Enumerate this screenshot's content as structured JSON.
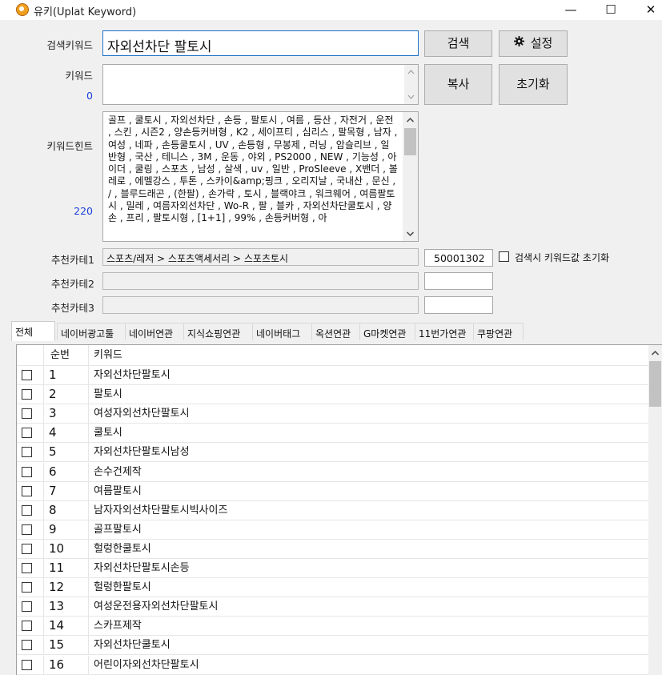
{
  "window": {
    "title": "유키(Uplat Keyword)",
    "icon": "app-logo-icon",
    "controls": [
      "—",
      "☐",
      "✕"
    ]
  },
  "form": {
    "search_label": "검색키워드",
    "search_value": "자외선차단 팔토시",
    "keyword_label": "키워드",
    "keyword_count": "0",
    "hint_label": "키워드힌트",
    "hint_count": "220",
    "hint_text": "골프 , 쿨토시 , 자외선차단 , 손등 , 팔토시 , 여름 , 등산 , 자전거 , 운전 , 스킨 , 시즌2 , 양손등커버형 , K2 , 세이프티 , 심리스 , 팔목형 , 남자 , 여성 , 네파 , 손등쿨토시 , UV , 손등형 , 무봉제 , 러닝 , 암슬리브 , 일반형 , 국산 , 테니스 , 3M , 운동 , 야외 , PS2000 , NEW , 기능성 , 아이더 , 쿨링 , 스포츠 , 남성 , 살색 , uv , 일반 , ProSleeve , X밴더 , 볼레로 , 에멜강스 , 투톤 , 스카이&amp;핑크 , 오리지날 , 국내산 , 문신 , / , 블루드래곤 , (한팔) , 손가락 , 토시 , 블랙야크 , 워크웨어 , 여름팔토시 , 밀레 , 여름자외선차단 , Wo-R , 팔 , 블카 , 자외선차단쿨토시 , 양손 , 프리 , 팔토시형 , [1+1] , 99% , 손등커버형 , 아",
    "buttons": {
      "search": "검색",
      "settings": "설정",
      "copy": "복사",
      "reset": "초기화"
    },
    "category1_label": "추천카테1",
    "category1_value": "스포츠/레저 > 스포츠액세서리 > 스포츠토시",
    "category1_code": "50001302",
    "category2_label": "추천카테2",
    "category2_value": "",
    "category2_code": "",
    "category3_label": "추천카테3",
    "category3_value": "",
    "category3_code": "",
    "reset_on_search_label": "검색시 키워드값 초기화"
  },
  "tabs": [
    "전체",
    "네이버광고툴",
    "네이버연관",
    "지식쇼핑연관",
    "네이버태그",
    "옥션연관",
    "G마켓연관",
    "11번가연관",
    "쿠팡연관"
  ],
  "grid": {
    "headers": {
      "num": "순번",
      "keyword": "키워드"
    },
    "rows": [
      {
        "num": "1",
        "keyword": "자외선차단팔토시"
      },
      {
        "num": "2",
        "keyword": "팔토시"
      },
      {
        "num": "3",
        "keyword": "여성자외선차단팔토시"
      },
      {
        "num": "4",
        "keyword": "쿨토시"
      },
      {
        "num": "5",
        "keyword": "자외선차단팔토시남성"
      },
      {
        "num": "6",
        "keyword": "손수건제작"
      },
      {
        "num": "7",
        "keyword": "여름팔토시"
      },
      {
        "num": "8",
        "keyword": "남자자외선차단팔토시빅사이즈"
      },
      {
        "num": "9",
        "keyword": "골프팔토시"
      },
      {
        "num": "10",
        "keyword": "헐렁한쿨토시"
      },
      {
        "num": "11",
        "keyword": "자외선차단팔토시손등"
      },
      {
        "num": "12",
        "keyword": "헐렁한팔토시"
      },
      {
        "num": "13",
        "keyword": "여성운전용자외선차단팔토시"
      },
      {
        "num": "14",
        "keyword": "스카프제작"
      },
      {
        "num": "15",
        "keyword": "자외선차단쿨토시"
      },
      {
        "num": "16",
        "keyword": "어린이자외선차단팔토시"
      }
    ]
  }
}
